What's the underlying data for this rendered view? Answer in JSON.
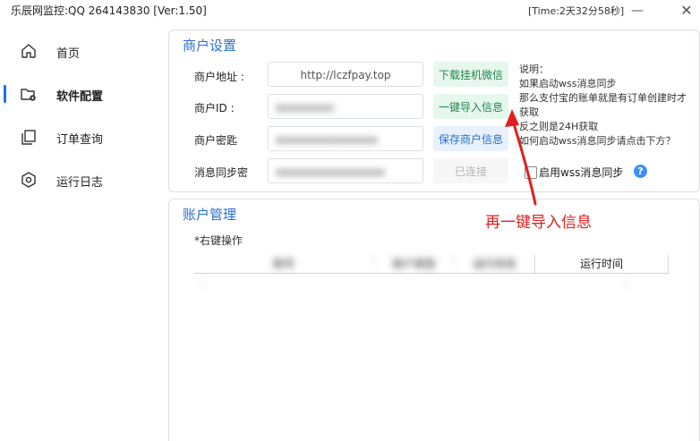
{
  "window": {
    "title": "乐辰网监控:QQ 264143830  [Ver:1.50]",
    "time_info": "[Time:2天32分58秒]",
    "min_label": "—",
    "close_label": "✕"
  },
  "sidebar": {
    "items": [
      {
        "label": "首页",
        "icon": "home-icon"
      },
      {
        "label": "软件配置",
        "icon": "folder-settings-icon",
        "active": true
      },
      {
        "label": "订单查询",
        "icon": "copy-icon"
      },
      {
        "label": "运行日志",
        "icon": "hexagon-gear-icon"
      }
    ]
  },
  "merchant": {
    "title": "商户设置",
    "address_label": "商户地址 :",
    "address_value": "http://lczfpay.top",
    "id_label": "商户ID :",
    "id_value": "▪▪▪▪▪▪▪▪",
    "key_label": "商户密匙",
    "key_value": "▪▪▪▪▪▪▪▪▪▪▪▪▪▪",
    "sync_label": "消息同步密",
    "sync_value": "▪▪▪▪▪▪▪▪▪▪▪▪▪▪▪",
    "btn_download": "下载挂机微信",
    "btn_import": "一键导入信息",
    "btn_save": "保存商户信息",
    "btn_connected": "已连接",
    "note_lines": [
      "说明：",
      "如果启动wss消息同步",
      "那么支付宝的账单就是有订单创建时才",
      "获取",
      "反之则是24H获取",
      "如何启动wss消息同步请点击下方？"
    ],
    "checkbox_label": "启用wss消息同步",
    "help_label": "?"
  },
  "account": {
    "title": "账户管理",
    "hint": "*右键操作",
    "columns": [
      "账号",
      "账户类型",
      "运行状态",
      "运行时间"
    ],
    "rows": [
      [
        "-",
        "",
        "",
        "-"
      ]
    ]
  },
  "annotation": {
    "text": "再一键导入信息",
    "color": "#e02020"
  },
  "colors": {
    "accent": "#2a6fd6",
    "green_button_bg": "#e6f7ee",
    "blue_button_bg": "#e8f1fd"
  }
}
